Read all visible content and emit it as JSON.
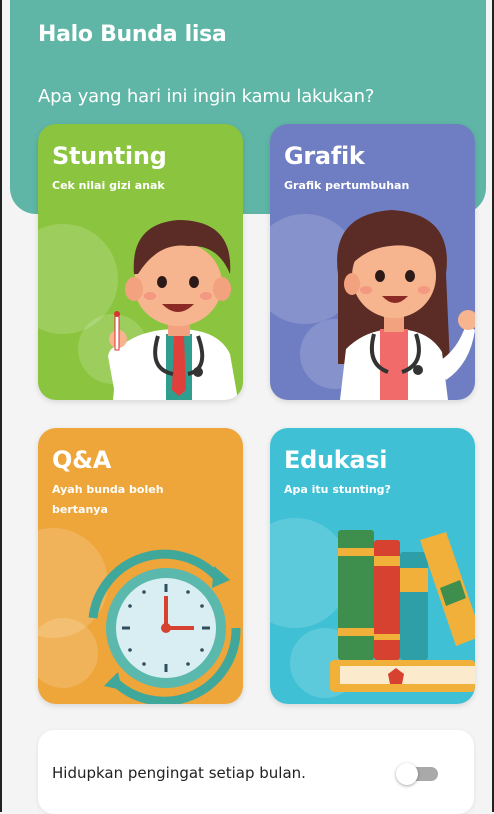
{
  "header": {
    "greeting": "Halo Bunda lisa",
    "prompt": "Apa yang hari ini ingin kamu lakukan?"
  },
  "cards": [
    {
      "title": "Stunting",
      "description": "Cek nilai gizi anak",
      "icon": "boy-doctor-illustration",
      "color": "#8bc53f"
    },
    {
      "title": "Grafik",
      "description": "Grafik pertumbuhan",
      "icon": "girl-doctor-illustration",
      "color": "#6f7ec2"
    },
    {
      "title": "Q&A",
      "description": "Ayah bunda boleh bertanya",
      "icon": "clock-illustration",
      "color": "#eea53a"
    },
    {
      "title": "Edukasi",
      "description": "Apa itu stunting?",
      "icon": "books-illustration",
      "color": "#3fc0d4"
    }
  ],
  "reminder": {
    "label": "Hidupkan pengingat setiap bulan.",
    "enabled": false
  },
  "colors": {
    "header": "#5fb6a6",
    "background": "#f4f4f4"
  }
}
